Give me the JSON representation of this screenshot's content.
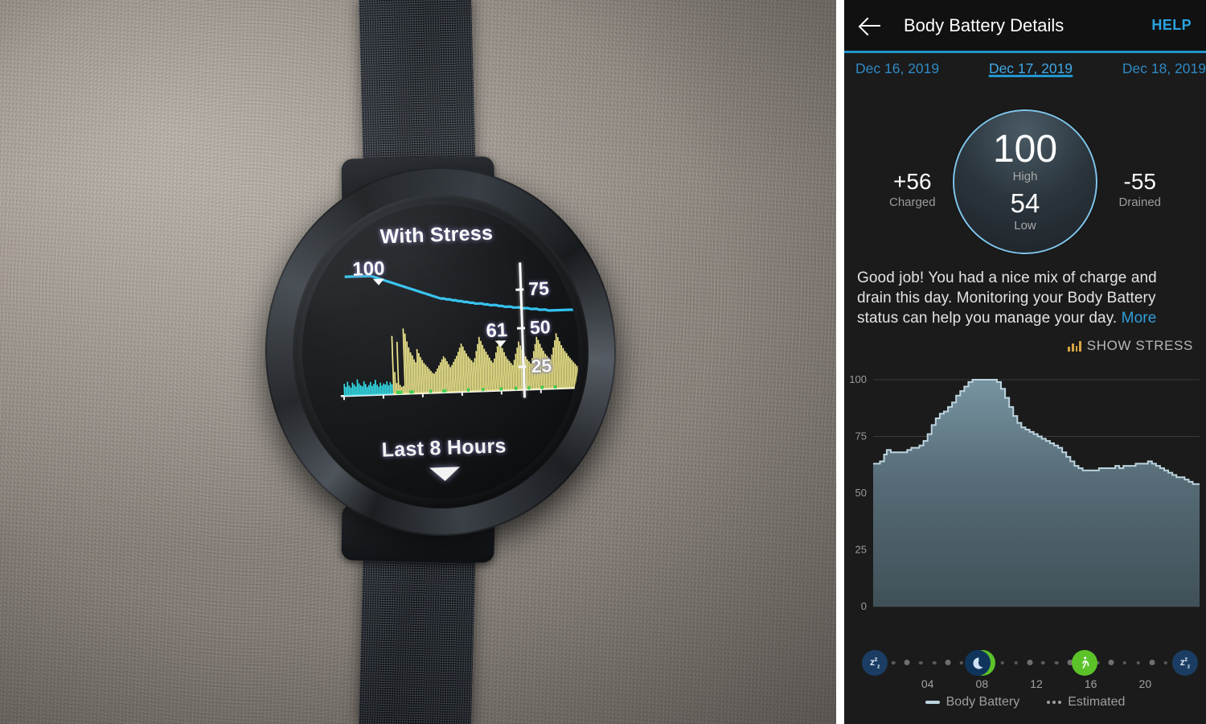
{
  "watch": {
    "title": "With Stress",
    "footer": "Last 8 Hours",
    "top_value": "100",
    "current_value": "61",
    "y_ticks": [
      "75",
      "50",
      "25"
    ],
    "colors": {
      "body_battery_line": "#2bc4f3",
      "stress_bars": "#f7ef8a",
      "rest_bars": "#25e3f0",
      "low_markers": "#36d94b"
    },
    "stress_bars": [
      12,
      9,
      14,
      10,
      8,
      13,
      11,
      9,
      16,
      12,
      10,
      9,
      14,
      11,
      8,
      10,
      13,
      9,
      11,
      15,
      10,
      8,
      12,
      9,
      11,
      10,
      13,
      9,
      12,
      10,
      58,
      22,
      11,
      52,
      9,
      7,
      8,
      65,
      60,
      52,
      46,
      41,
      38,
      34,
      31,
      44,
      40,
      36,
      33,
      30,
      28,
      26,
      24,
      22,
      20,
      19,
      21,
      24,
      27,
      30,
      33,
      36,
      34,
      31,
      28,
      25,
      27,
      30,
      33,
      36,
      40,
      44,
      48,
      45,
      41,
      38,
      35,
      33,
      31,
      29,
      33,
      40,
      47,
      54,
      50,
      46,
      42,
      39,
      36,
      33,
      30,
      28,
      32,
      38,
      44,
      50,
      46,
      42,
      38,
      34,
      31,
      29,
      27,
      25,
      30,
      36,
      42,
      48,
      44,
      40,
      36,
      33,
      30,
      28,
      26,
      31,
      38,
      45,
      52,
      49,
      45,
      41,
      38,
      35,
      33,
      31,
      29,
      34,
      41,
      48,
      55,
      51,
      47,
      43,
      40,
      37,
      35,
      32,
      30,
      28,
      26,
      24,
      22,
      20
    ],
    "rest_bars": [
      10,
      7,
      12,
      8,
      6,
      11,
      9,
      7,
      14,
      10,
      8,
      7,
      12,
      9,
      6,
      8,
      11,
      7,
      9,
      13,
      8,
      6,
      10,
      7,
      9,
      8,
      11,
      7,
      10,
      8
    ],
    "body_battery_curve": [
      100,
      100,
      100,
      100,
      100,
      100,
      100,
      100,
      100,
      100,
      99,
      98,
      97,
      96,
      95,
      94,
      93,
      92,
      91,
      90,
      89,
      88,
      87,
      86,
      85,
      84,
      83,
      82,
      81,
      80,
      79,
      78,
      77,
      76,
      76,
      75,
      75,
      74,
      74,
      73,
      73,
      72,
      72,
      71,
      71,
      70,
      70,
      70,
      69,
      69,
      68,
      68,
      68,
      67,
      67,
      66,
      66,
      66,
      65,
      65,
      65,
      64,
      64,
      64,
      63,
      63,
      63,
      62,
      62,
      62,
      61,
      61,
      61,
      61,
      61,
      61,
      61,
      61,
      61,
      61
    ]
  },
  "app": {
    "header": {
      "title": "Body Battery Details",
      "help_label": "HELP",
      "back_icon": "back-arrow-icon"
    },
    "tabs": [
      {
        "label": "Dec 16, 2019",
        "active": false
      },
      {
        "label": "Dec 17, 2019",
        "active": true
      },
      {
        "label": "Dec 18, 2019",
        "active": false
      }
    ],
    "summary": {
      "high_value": "100",
      "high_label": "High",
      "low_value": "54",
      "low_label": "Low",
      "charged_value": "+56",
      "charged_label": "Charged",
      "drained_value": "-55",
      "drained_label": "Drained"
    },
    "description": {
      "text": "Good job! You had a nice mix of charge and drain this day. Monitoring your Body Battery status can help you manage your day. ",
      "more_label": "More"
    },
    "show_stress": {
      "label": "SHOW STRESS",
      "icon": "bar-chart-icon",
      "icon_color": "#d9a441"
    },
    "legend": [
      {
        "label": "Body Battery",
        "style": "line",
        "color": "#bcd4df"
      },
      {
        "label": "Estimated",
        "style": "dotted",
        "color": "#9f9f9f"
      }
    ],
    "timeline": {
      "hour_labels": [
        "04",
        "08",
        "12",
        "16",
        "20"
      ],
      "markers": [
        {
          "type": "sleep",
          "icon": "sleep-zzz-icon",
          "pos": 0.5
        },
        {
          "type": "moon",
          "icon": "moon-icon",
          "pos": 32.0
        },
        {
          "type": "walk",
          "icon": "walking-person-icon",
          "pos": 33.4
        },
        {
          "type": "walk",
          "icon": "walking-person-icon",
          "pos": 64.9
        },
        {
          "type": "sleep",
          "icon": "sleep-zzz-icon",
          "pos": 95.5
        }
      ]
    },
    "colors": {
      "accent": "#2196cf",
      "link": "#2f9fdc",
      "background": "#1b1b1b",
      "appbar": "#111111",
      "chart_line": "#bcd4df",
      "walk_marker": "#5cc22a",
      "sleep_marker": "#1b3d63"
    }
  },
  "chart_data": {
    "type": "area",
    "title": "Body Battery",
    "xlabel": "",
    "ylabel": "",
    "ylim": [
      0,
      100
    ],
    "yticks": [
      0,
      25,
      50,
      75,
      100
    ],
    "xticks": [
      4,
      8,
      12,
      16,
      20
    ],
    "xlim": [
      0,
      24
    ],
    "grid": true,
    "legend_position": "bottom",
    "series": [
      {
        "name": "Body Battery",
        "x": [
          0.0,
          0.5,
          0.8,
          1.0,
          1.3,
          1.6,
          1.9,
          2.2,
          2.5,
          2.8,
          3.1,
          3.4,
          3.7,
          4.0,
          4.3,
          4.6,
          4.9,
          5.2,
          5.5,
          5.8,
          6.1,
          6.4,
          6.7,
          7.0,
          7.3,
          7.6,
          7.9,
          8.2,
          8.5,
          8.8,
          9.1,
          9.4,
          9.7,
          10.0,
          10.3,
          10.6,
          10.9,
          11.2,
          11.5,
          11.8,
          12.1,
          12.4,
          12.7,
          13.0,
          13.3,
          13.6,
          13.9,
          14.2,
          14.5,
          14.8,
          15.1,
          15.4,
          15.7,
          16.0,
          16.3,
          16.6,
          16.9,
          17.2,
          17.5,
          17.8,
          18.1,
          18.4,
          18.7,
          19.0,
          19.3,
          19.6,
          19.9,
          20.2,
          20.5,
          20.8,
          21.1,
          21.4,
          21.7,
          22.0,
          22.3,
          22.6,
          22.9,
          23.2,
          23.5,
          23.8,
          24.0
        ],
        "y": [
          63,
          64,
          67,
          69,
          68,
          68,
          68,
          68,
          69,
          70,
          70,
          71,
          73,
          76,
          80,
          83,
          85,
          86,
          88,
          90,
          93,
          95,
          97,
          99,
          100,
          100,
          100,
          100,
          100,
          100,
          99,
          96,
          92,
          88,
          84,
          81,
          79,
          78,
          77,
          76,
          75,
          74,
          73,
          72,
          71,
          70,
          68,
          66,
          64,
          62,
          61,
          60,
          60,
          60,
          60,
          61,
          61,
          61,
          61,
          62,
          61,
          62,
          62,
          62,
          63,
          63,
          63,
          64,
          63,
          62,
          61,
          60,
          59,
          58,
          57,
          57,
          56,
          55,
          54,
          54,
          54,
          54,
          54,
          55,
          56,
          55,
          54,
          54,
          54,
          56,
          60,
          63,
          64
        ]
      }
    ]
  }
}
